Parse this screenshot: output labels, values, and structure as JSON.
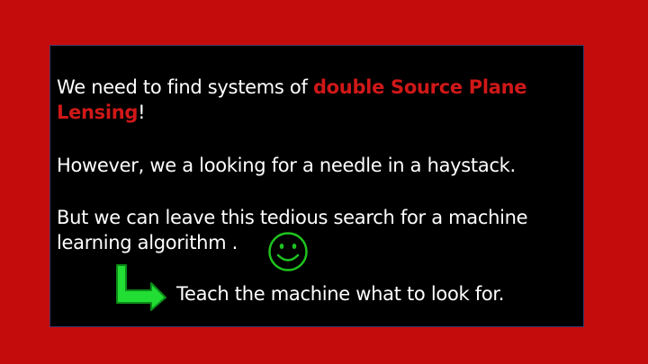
{
  "colors": {
    "background": "#c40c0c",
    "panel": "#000000",
    "text": "#ffffff",
    "highlight": "#d01818",
    "smiley": "#1fc21f",
    "arrow": "#22dd33"
  },
  "slide": {
    "p1": {
      "before": "We need to find systems of ",
      "highlight_line1": "double Source Plane",
      "highlight_line2": "Lensing",
      "after": "!"
    },
    "p2": "However, we a looking for a needle in a haystack.",
    "p3": {
      "line1": "But we can leave this tedious search for a machine",
      "line2": "learning algorithm ."
    },
    "p4": "Teach the machine what to look for.",
    "icons": {
      "smiley": "smiley-face-icon",
      "arrow": "bent-arrow-icon"
    }
  }
}
